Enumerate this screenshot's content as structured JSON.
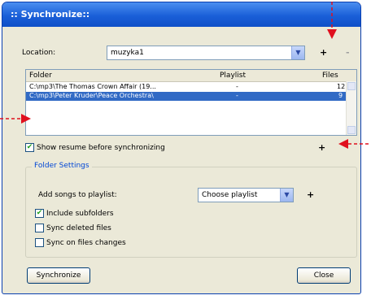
{
  "window": {
    "title": ":: Synchronize::"
  },
  "location": {
    "label": "Location:",
    "value": "muzyka1",
    "add": "+",
    "remove": "-"
  },
  "list": {
    "columns": {
      "folder": "Folder",
      "playlist": "Playlist",
      "files": "Files"
    },
    "rows": [
      {
        "folder": "C:\\mp3\\The Thomas Crown Affair (19...",
        "playlist": "-",
        "files": "12"
      },
      {
        "folder": "C:\\mp3\\Peter Kruder\\Peace Orchestra\\",
        "playlist": "-",
        "files": "9"
      }
    ]
  },
  "show_resume": {
    "label": "Show resume before synchronizing",
    "checked": true
  },
  "add_folder": "+",
  "folder_settings": {
    "title": "Folder Settings",
    "add_songs_label": "Add songs to playlist:",
    "playlist_value": "Choose playlist",
    "add": "+",
    "include_subfolders": {
      "label": "Include subfolders",
      "checked": true
    },
    "sync_deleted": {
      "label": "Sync deleted files",
      "checked": false
    },
    "sync_changes": {
      "label": "Sync on files changes",
      "checked": false
    }
  },
  "buttons": {
    "synchronize": "Synchronize",
    "close": "Close"
  },
  "colors": {
    "titlebar": "#1a5fd8",
    "selection": "#316ac5",
    "annotation_arrow": "#e0101e"
  }
}
